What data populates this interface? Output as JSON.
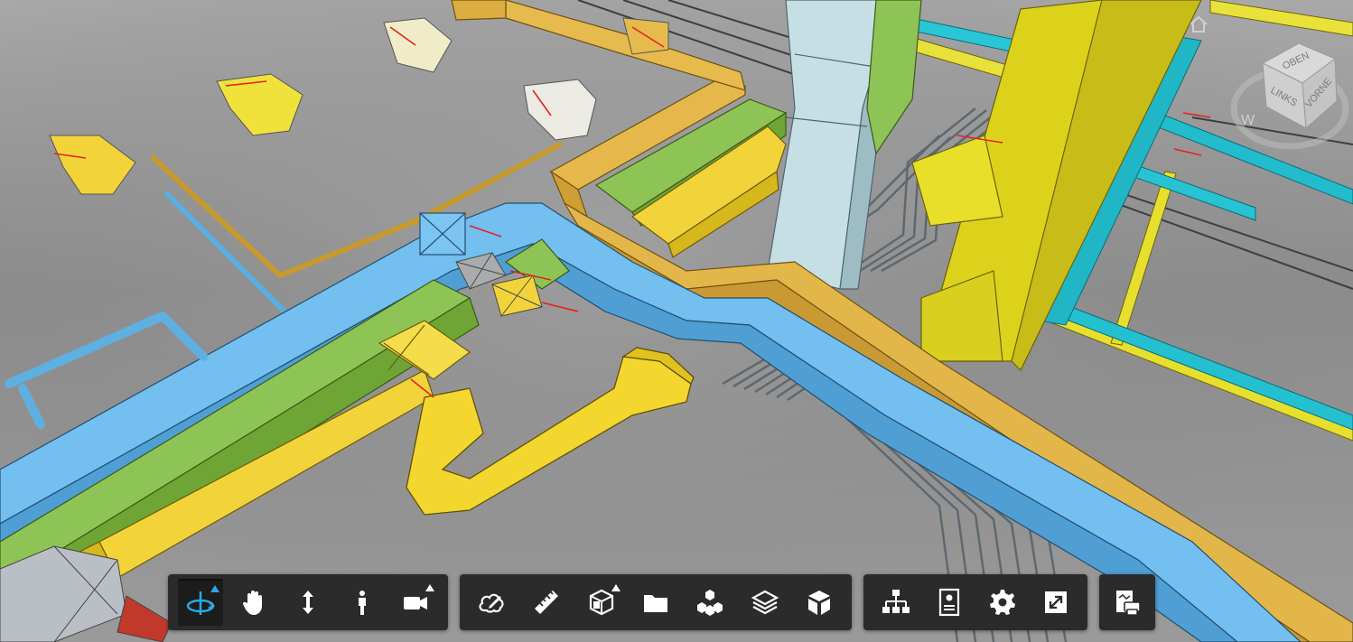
{
  "app": {
    "type": "3d-model-viewer"
  },
  "viewcube": {
    "faces": {
      "top": "OBEN",
      "left": "LINKS",
      "front": "VORNE"
    },
    "compass_mark": "W"
  },
  "toolbar": {
    "groups": [
      {
        "id": "navigation",
        "tools": [
          {
            "icon": "orbit-icon",
            "active": true,
            "flyout": true
          },
          {
            "icon": "pan-icon",
            "active": false,
            "flyout": false
          },
          {
            "icon": "zoom-icon",
            "active": false,
            "flyout": false
          },
          {
            "icon": "first-person-icon",
            "active": false,
            "flyout": false
          },
          {
            "icon": "camera-icon",
            "active": false,
            "flyout": true
          }
        ]
      },
      {
        "id": "modeling-tools",
        "tools": [
          {
            "icon": "markup-icon"
          },
          {
            "icon": "measure-icon"
          },
          {
            "icon": "section-icon",
            "flyout": true
          },
          {
            "icon": "explode-icon"
          },
          {
            "icon": "model-browser-icon"
          },
          {
            "icon": "layers-icon"
          },
          {
            "icon": "3d-view-icon"
          }
        ]
      },
      {
        "id": "settings",
        "tools": [
          {
            "icon": "model-tree-icon"
          },
          {
            "icon": "properties-icon"
          },
          {
            "icon": "settings-gear-icon"
          },
          {
            "icon": "fullscreen-icon"
          }
        ]
      },
      {
        "id": "extra",
        "tools": [
          {
            "icon": "print-icon"
          }
        ]
      }
    ],
    "active_color": "#2aa8e8"
  },
  "colors": {
    "supply_duct": "#6cbcf0",
    "exhaust_duct": "#e3b64a",
    "return_duct": "#f2d43a",
    "outdoor_duct": "#8ec455",
    "pipe_cyan": "#25c3d3",
    "column": "#c4dde2",
    "background": "#8e8e8e"
  }
}
